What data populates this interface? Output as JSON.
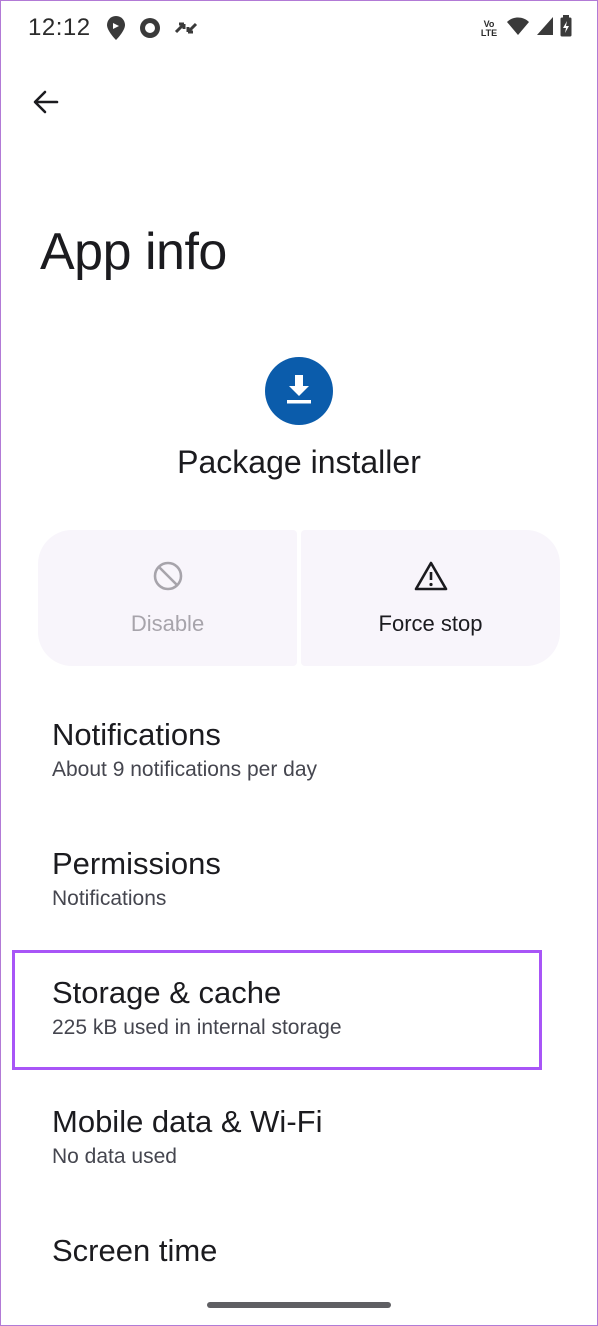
{
  "status_bar": {
    "time": "12:12",
    "volte_label": "Vo LTE",
    "icons": [
      "location-pin-icon",
      "circle-record-icon",
      "swap-arrows-icon",
      "volte-icon",
      "wifi-icon",
      "signal-icon",
      "battery-icon"
    ]
  },
  "header": {
    "back_icon": "arrow-back-icon",
    "title": "App info"
  },
  "app": {
    "name": "Package installer",
    "icon": "download-icon",
    "icon_color": "#0b5cab"
  },
  "actions": [
    {
      "label": "Disable",
      "icon": "block-icon",
      "enabled": false
    },
    {
      "label": "Force stop",
      "icon": "warning-icon",
      "enabled": true
    }
  ],
  "settings": [
    {
      "title": "Notifications",
      "subtitle": "About 9 notifications per day"
    },
    {
      "title": "Permissions",
      "subtitle": "Notifications"
    },
    {
      "title": "Storage & cache",
      "subtitle": "225 kB used in internal storage",
      "highlighted": true
    },
    {
      "title": "Mobile data & Wi-Fi",
      "subtitle": "No data used"
    },
    {
      "title": "Screen time",
      "subtitle": ""
    }
  ],
  "colors": {
    "highlight": "#a855f7",
    "action_background": "#f8f5fb"
  }
}
